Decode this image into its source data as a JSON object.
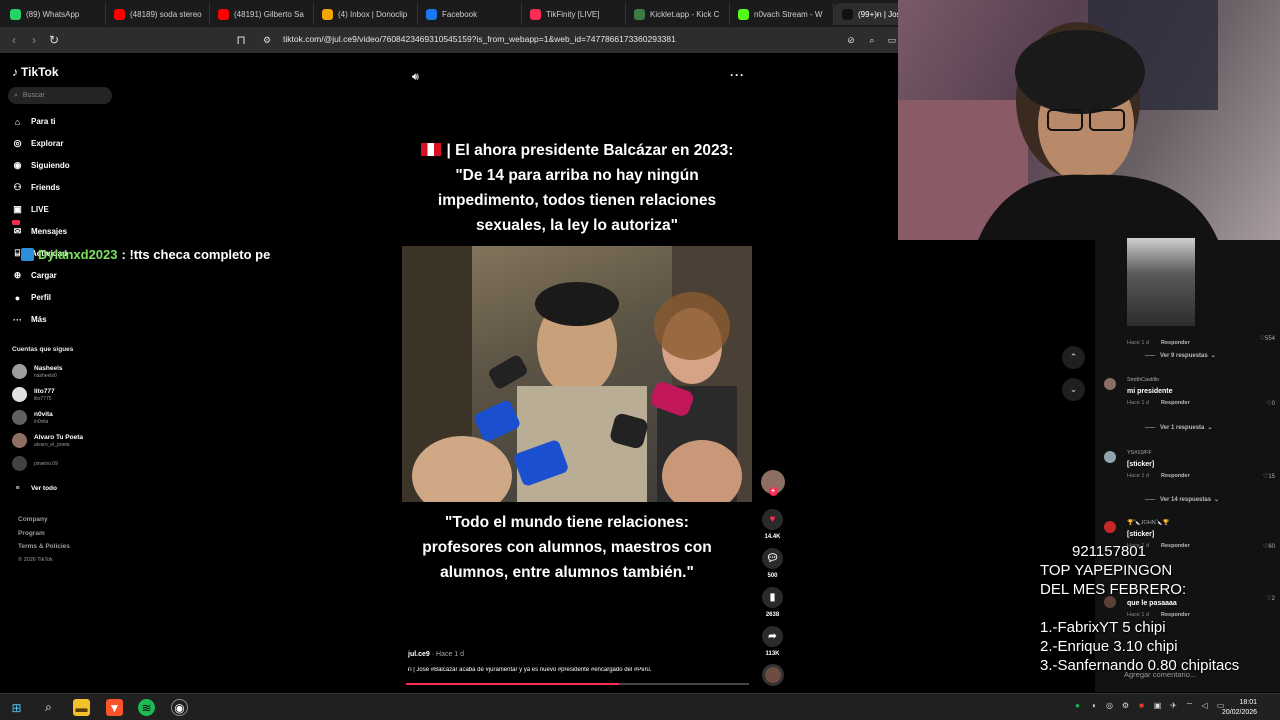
{
  "browser": {
    "tabs": [
      {
        "label": "(89) WhatsApp",
        "color": "#25d366"
      },
      {
        "label": "(48189) soda stereo",
        "color": "#ff0000"
      },
      {
        "label": "(48191) Gilberto Sa",
        "color": "#ff0000"
      },
      {
        "label": "(4) Inbox | Donoclip",
        "color": "#f0a500"
      },
      {
        "label": "Facebook",
        "color": "#1877f2"
      },
      {
        "label": "TikFinity [LIVE]",
        "color": "#fe2c55"
      },
      {
        "label": "Kicklet.app - Kick C",
        "color": "#3a7d44"
      },
      {
        "label": "n0vach Stream - W",
        "color": "#53fc18"
      },
      {
        "label": "(99+)ғι | Jos",
        "color": "#111111"
      }
    ],
    "url": "tiktok.com/@jul.ce9/video/7608423469310545159?is_from_webapp=1&web_id=7477866173360293381"
  },
  "sidebar": {
    "logo": "TikTok",
    "search_placeholder": "Buscar",
    "nav": [
      {
        "label": "Para ti",
        "icon": "home-icon"
      },
      {
        "label": "Explorar",
        "icon": "compass-icon"
      },
      {
        "label": "Siguiendo",
        "icon": "following-icon"
      },
      {
        "label": "Friends",
        "icon": "friends-icon"
      },
      {
        "label": "LIVE",
        "icon": "live-icon"
      },
      {
        "label": "Mensajes",
        "icon": "message-icon"
      },
      {
        "label": "Actividad",
        "icon": "inbox-icon"
      },
      {
        "label": "Cargar",
        "icon": "upload-icon"
      },
      {
        "label": "Perfil",
        "icon": "profile-icon"
      },
      {
        "label": "Más",
        "icon": "more-icon"
      }
    ],
    "following_header": "Cuentas que sigues",
    "following": [
      {
        "name": "Nasheels",
        "handle": "nasheels0"
      },
      {
        "name": "lito777",
        "handle": "lito7775"
      },
      {
        "name": "n0vita",
        "handle": "in0vita"
      },
      {
        "name": "Alvaro Tu Poeta",
        "handle": "alvaro_el_poeta"
      },
      {
        "name": "",
        "handle": "pinwino.09"
      }
    ],
    "see_all": "Ver todo",
    "footer": [
      "Company",
      "Program",
      "Terms & Policies",
      "© 2026 TikTok"
    ]
  },
  "overlay_chat": {
    "user": "Dylanxd2023",
    "message": ": !tts checa completo pe"
  },
  "video": {
    "headline": "| El ahora presidente Balcázar en 2023: \"De 14 para arriba no hay ningún impedimento, todos tienen relaciones sexuales, la ley lo autoriza\"",
    "quote": "\"Todo el mundo tiene relaciones: profesores con alumnos, maestros con alumnos, entre alumnos también.\"",
    "author": "jul.ce9",
    "time": " · Hace 1 d",
    "caption": "ғι | José #Balcázar acaba de #juramentar y ya es nuevo #presidente #encargado del #Perú.",
    "progress": 0.62,
    "actions": {
      "likes": "14.4K",
      "comments": "500",
      "saves": "2638",
      "shares": "113K"
    }
  },
  "comments": [
    {
      "user": "",
      "text": "",
      "time": "Hace 1 d",
      "reply": "Responder",
      "likes": "554",
      "replies": "Ver 9 respuestas"
    },
    {
      "user": "SmithCastillo",
      "text": "mi presidente",
      "time": "Hace 1 d",
      "reply": "Responder",
      "likes": "0",
      "replies": "Ver 1 respuesta"
    },
    {
      "user": "YS#10/FF",
      "text": "[sticker]",
      "time": "Hace 1 d",
      "reply": "Responder",
      "likes": "15",
      "replies": "Ver 14 respuestas"
    },
    {
      "user": "🏆🔪JOHN🔪🏆",
      "text": "[sticker]",
      "time": "Hace 1 d",
      "reply": "Responder",
      "likes": "60",
      "replies": ""
    },
    {
      "user": "",
      "text": "que le pasaaaa",
      "time": "Hace 1 d",
      "reply": "Responder",
      "likes": "2",
      "replies": ""
    }
  ],
  "comment_input_placeholder": "Agregar comentario...",
  "donation": {
    "phone": "921157801",
    "title_1": "TOP YAPEPINGON",
    "title_2": "DEL MES FEBRERO:",
    "entries": [
      "1.-FabrixYT 5 chipi",
      "2.-Enrique 3.10 chipi",
      "3.-Sanfernando 0.80 chipitacs"
    ]
  },
  "taskbar": {
    "time": "18:01",
    "date": "20/02/2026"
  },
  "colors": {
    "accent": "#fe2c55",
    "chat_user": "#7ce35a"
  }
}
